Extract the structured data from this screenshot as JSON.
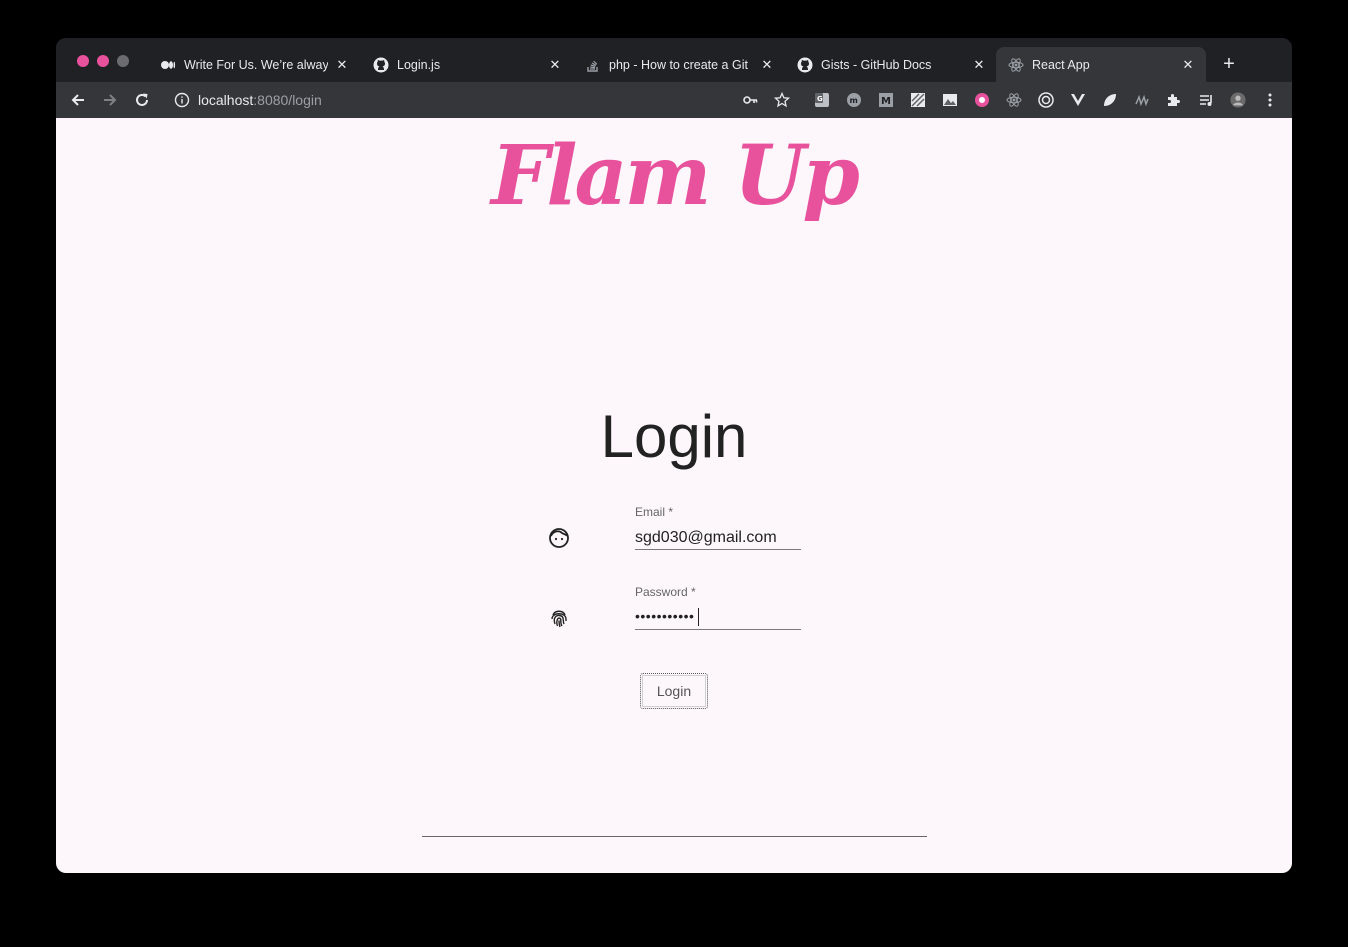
{
  "browser": {
    "tabs": [
      {
        "title": "Write For Us. We’re always",
        "icon": "medium-icon"
      },
      {
        "title": "Login.js",
        "icon": "github-icon"
      },
      {
        "title": "php - How to create a Git",
        "icon": "stackoverflow-icon"
      },
      {
        "title": "Gists - GitHub Docs",
        "icon": "github-icon"
      },
      {
        "title": "React App",
        "icon": "react-icon",
        "active": true
      }
    ],
    "url_host": "localhost",
    "url_rest": ":8080/login",
    "close_glyph": "✕",
    "new_tab_glyph": "+"
  },
  "page": {
    "logo_text": "Flam Up",
    "title": "Login",
    "email": {
      "label": "Email",
      "required_mark": " *",
      "value": "sgd030@gmail.com"
    },
    "password": {
      "label": "Password",
      "required_mark": " *",
      "masked_value": "•••••••••••"
    },
    "login_button": "Login"
  },
  "colors": {
    "brand_pink": "#e8519c",
    "page_background": "#fdf6fa",
    "chrome_dark": "#202124"
  }
}
